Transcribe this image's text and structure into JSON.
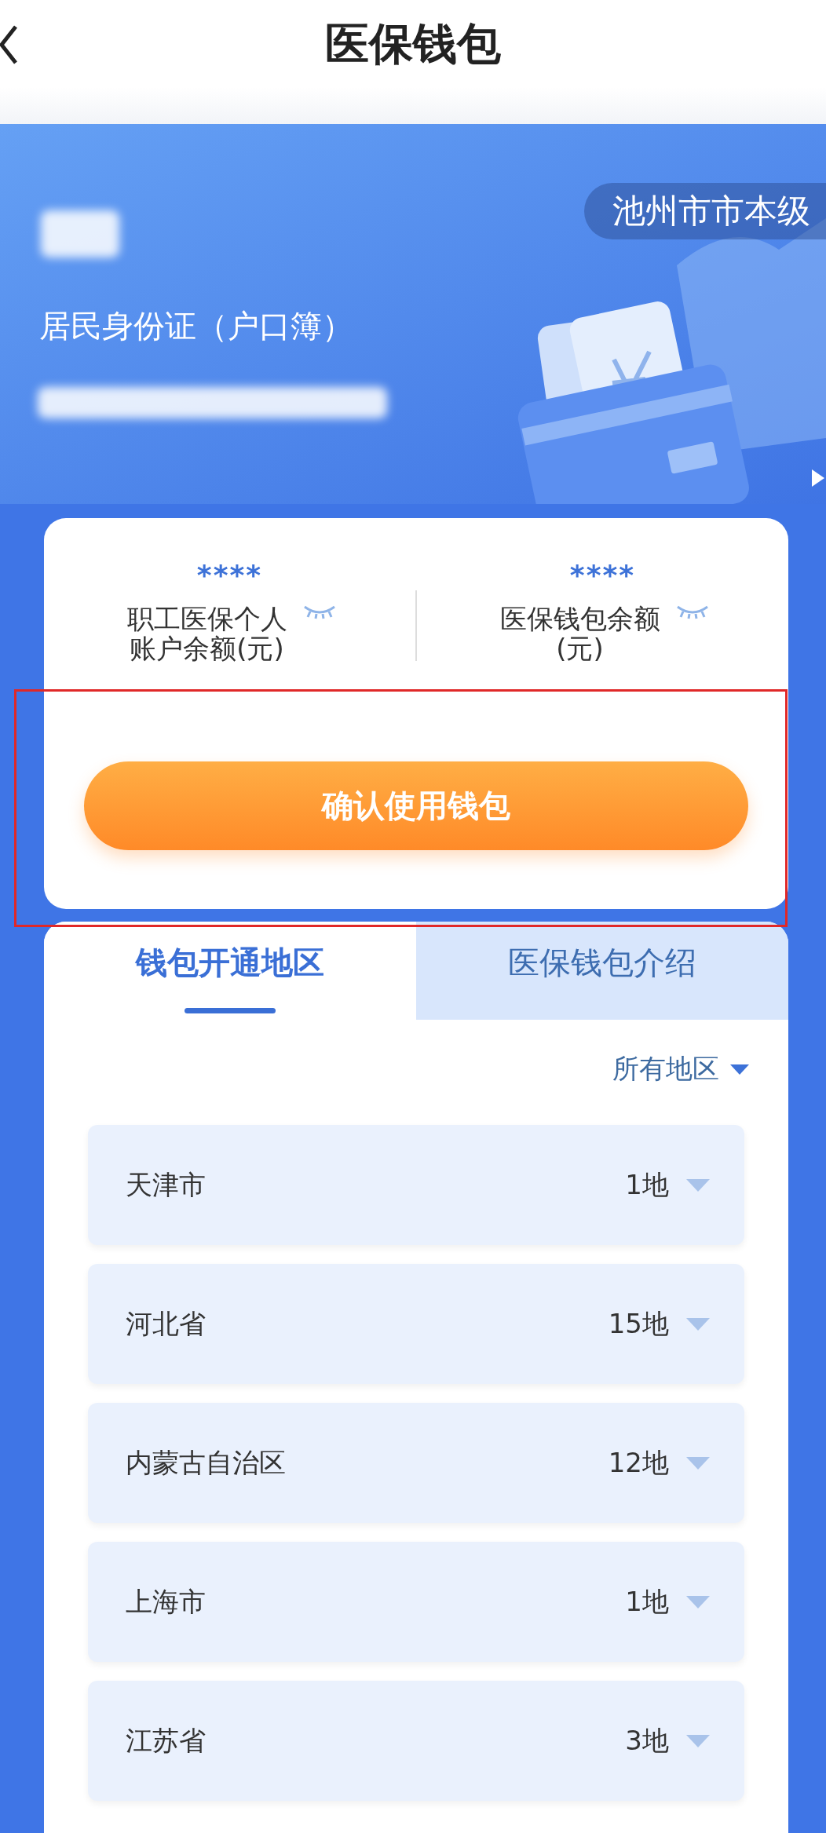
{
  "header": {
    "title": "医保钱包"
  },
  "banner": {
    "region": "池州市市本级",
    "id_type": "居民身份证（户口簿）"
  },
  "balances": [
    {
      "amount": "****",
      "label": "职工医保个人账户余额(元)"
    },
    {
      "amount": "****",
      "label": "医保钱包余额(元)"
    }
  ],
  "confirm_button": "确认使用钱包",
  "tabs": [
    {
      "label": "钱包开通地区",
      "selected": true
    },
    {
      "label": "医保钱包介绍",
      "selected": false
    }
  ],
  "filter": "所有地区",
  "regions": [
    {
      "name": "天津市",
      "count": "1地"
    },
    {
      "name": "河北省",
      "count": "15地"
    },
    {
      "name": "内蒙古自治区",
      "count": "12地"
    },
    {
      "name": "上海市",
      "count": "1地"
    },
    {
      "name": "江苏省",
      "count": "3地"
    }
  ]
}
